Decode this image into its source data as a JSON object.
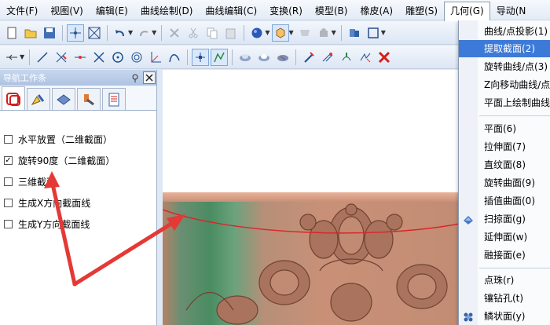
{
  "menubar": {
    "items": [
      "文件(F)",
      "视图(V)",
      "编辑(E)",
      "曲线绘制(D)",
      "曲线编辑(C)",
      "变换(R)",
      "模型(B)",
      "橡皮(A)",
      "雕塑(S)",
      "几何(G)",
      "导动(N"
    ]
  },
  "toolbar1": {
    "icons": [
      "new-file-icon",
      "open-folder-icon",
      "save-icon",
      "grid-snap-icon",
      "window-fit-icon",
      "undo-icon",
      "redo-icon",
      "delete-icon",
      "cut-icon",
      "copy-icon",
      "paste-icon",
      "sphere-shade-icon",
      "view-cube-icon",
      "surface-icon",
      "body-icon",
      "material-icon",
      "frame-icon"
    ]
  },
  "toolbar2": {
    "icons": [
      "move-icon",
      "line-icon",
      "trim-icon",
      "extend-icon",
      "cross-icon",
      "circle-icon",
      "ring-icon",
      "axis-icon",
      "curve-icon",
      "point-grid-icon",
      "curve-edit-icon",
      "render-a-icon",
      "render-b-icon",
      "render-c-icon",
      "tool-a-icon",
      "tool-b-icon",
      "tool-c-icon",
      "tool-d-icon",
      "cancel-icon"
    ]
  },
  "nav_panel": {
    "title": "导航工作条",
    "pin_icon": "pin-icon",
    "close_icon": "close-icon",
    "tabs": [
      "layer-tab-icon",
      "edit-tab-icon",
      "shape-tab-icon",
      "tool-tab-icon",
      "document-tab-icon"
    ],
    "options": [
      {
        "label": "水平放置（二维截面）",
        "checked": false
      },
      {
        "label": "旋转90度（二维截面）",
        "checked": true
      },
      {
        "label": "三维截面",
        "checked": false
      },
      {
        "label": "生成X方向截面线",
        "checked": false
      },
      {
        "label": "生成Y方向截面线",
        "checked": false
      }
    ]
  },
  "geometry_menu": {
    "items": [
      {
        "label": "曲线/点投影(1)",
        "highlighted": false
      },
      {
        "label": "提取截面(2)",
        "highlighted": true
      },
      {
        "label": "旋转曲线/点(3)",
        "highlighted": false
      },
      {
        "label": "Z向移动曲线/点",
        "highlighted": false
      },
      {
        "label": "平面上绘制曲线",
        "highlighted": false
      },
      {
        "label": "平面(6)",
        "highlighted": false
      },
      {
        "label": "拉伸面(7)",
        "highlighted": false
      },
      {
        "label": "直纹面(8)",
        "highlighted": false
      },
      {
        "label": "旋转曲面(9)",
        "highlighted": false
      },
      {
        "label": "插值曲面(0)",
        "highlighted": false
      },
      {
        "label": "扫掠面(g)",
        "highlighted": false,
        "icon": "sweep-icon"
      },
      {
        "label": "延伸面(w)",
        "highlighted": false
      },
      {
        "label": "融接面(e)",
        "highlighted": false
      },
      {
        "label": "点珠(r)",
        "highlighted": false
      },
      {
        "label": "镶钻孔(t)",
        "highlighted": false
      },
      {
        "label": "鳞状面(y)",
        "highlighted": false,
        "icon": "scale-surface-icon"
      }
    ]
  },
  "colors": {
    "menu_highlight": "#3d7ad8",
    "annotation_arrow": "#e53935",
    "section_curve": "#d9262a",
    "relief_copper": "#c99077",
    "relief_green": "#4a8c62"
  }
}
